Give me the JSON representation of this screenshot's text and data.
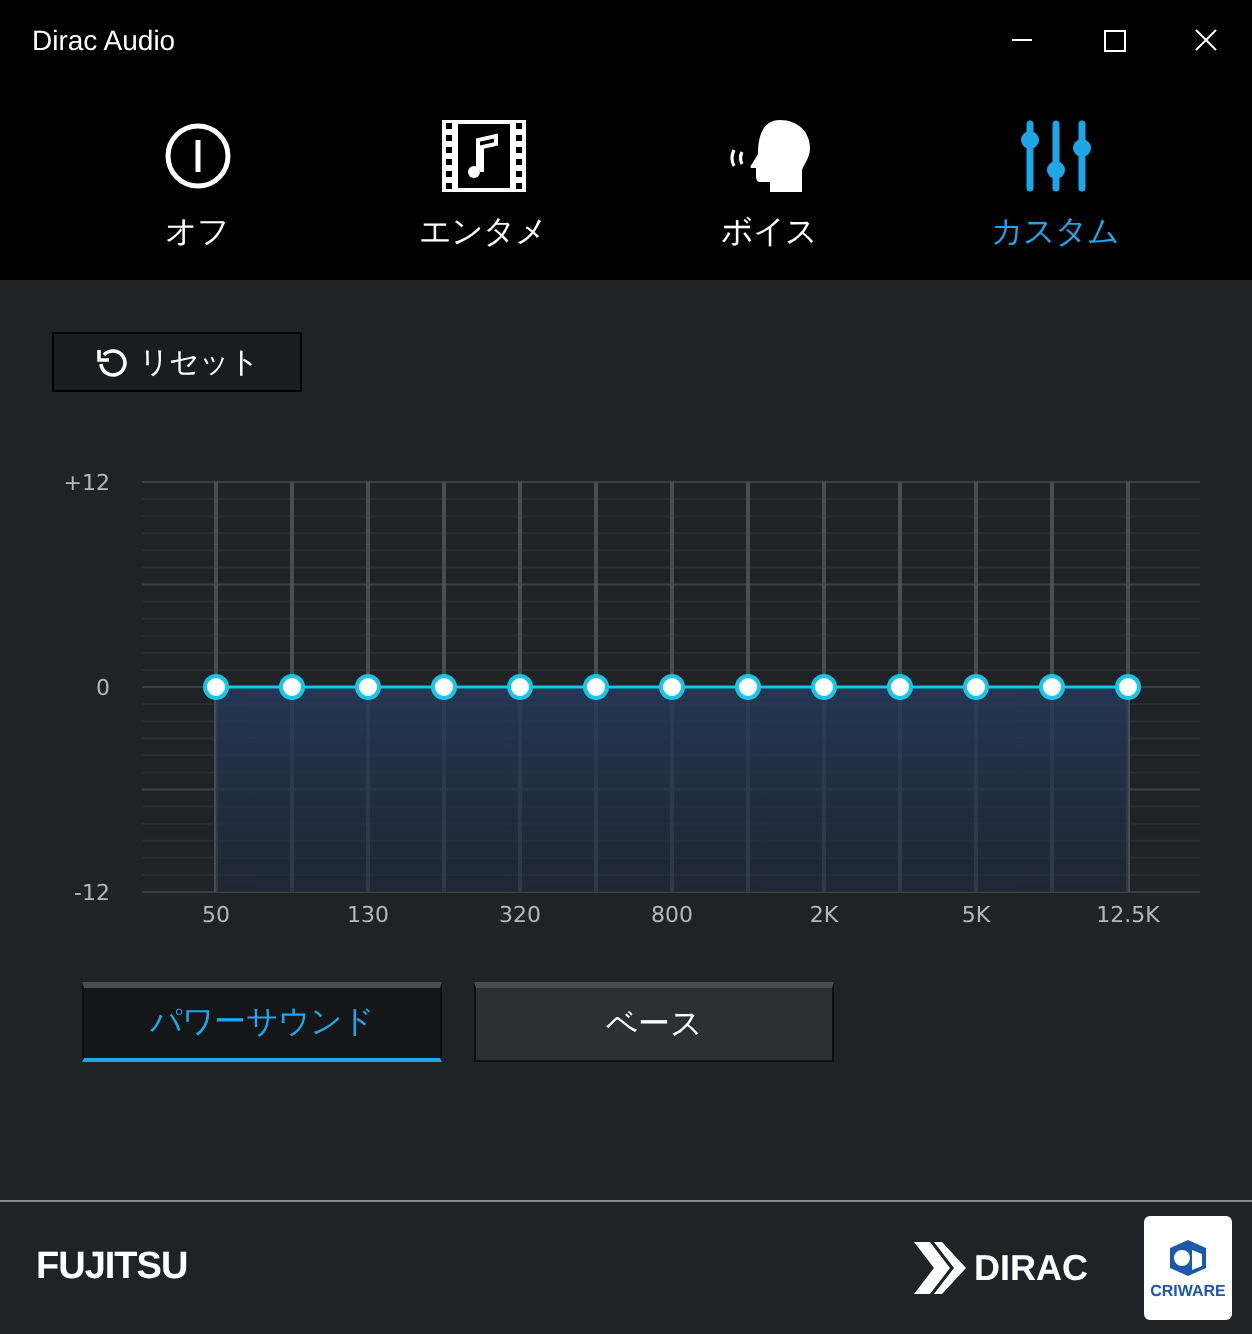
{
  "window": {
    "title": "Dirac Audio"
  },
  "modes": [
    {
      "label": "オフ",
      "kind": "power",
      "selected": false
    },
    {
      "label": "エンタメ",
      "kind": "film",
      "selected": false
    },
    {
      "label": "ボイス",
      "kind": "voice",
      "selected": false
    },
    {
      "label": "カスタム",
      "kind": "eq",
      "selected": true
    }
  ],
  "reset_button": {
    "label": "リセット"
  },
  "equalizer": {
    "chart_data": {
      "type": "line",
      "grid": true,
      "marker": "circle",
      "categories": [
        "50",
        null,
        "130",
        null,
        "320",
        null,
        "800",
        null,
        "2K",
        null,
        "5K",
        null,
        "12.5K"
      ],
      "values": [
        0,
        0,
        0,
        0,
        0,
        0,
        0,
        0,
        0,
        0,
        0,
        0,
        0
      ],
      "ylim": [
        -12,
        12
      ],
      "yticks": [
        {
          "value": 12,
          "label": "+12"
        },
        {
          "value": 0,
          "label": "0"
        },
        {
          "value": -12,
          "label": "-12"
        }
      ]
    }
  },
  "presets": [
    {
      "label": "パワーサウンド",
      "selected": true
    },
    {
      "label": "ベース",
      "selected": false
    }
  ],
  "footer": {
    "brand_left": "FUJITSU",
    "brand_dirac": "DIRAC",
    "brand_cri": "CRIWARE"
  }
}
